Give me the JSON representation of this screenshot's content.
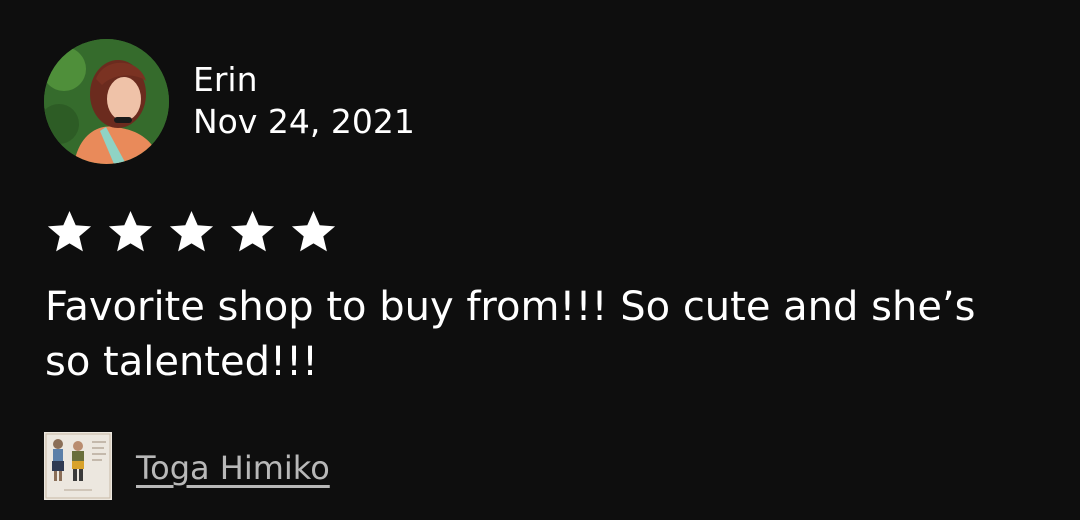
{
  "review": {
    "author": {
      "name": "Erin",
      "avatar": "profile-photo"
    },
    "date": "Nov 24, 2021",
    "rating": 5,
    "rating_max": 5,
    "text": "Favorite shop to buy from!!! So cute and she’s so talented!!!",
    "item": {
      "title": "Toga Himiko",
      "thumbnail": "item-sketch-thumbnail"
    }
  },
  "colors": {
    "background": "#0e0e0e",
    "text": "#ffffff",
    "link": "#b8b8b8",
    "star": "#ffffff"
  },
  "icons": {
    "star": "star-icon"
  }
}
